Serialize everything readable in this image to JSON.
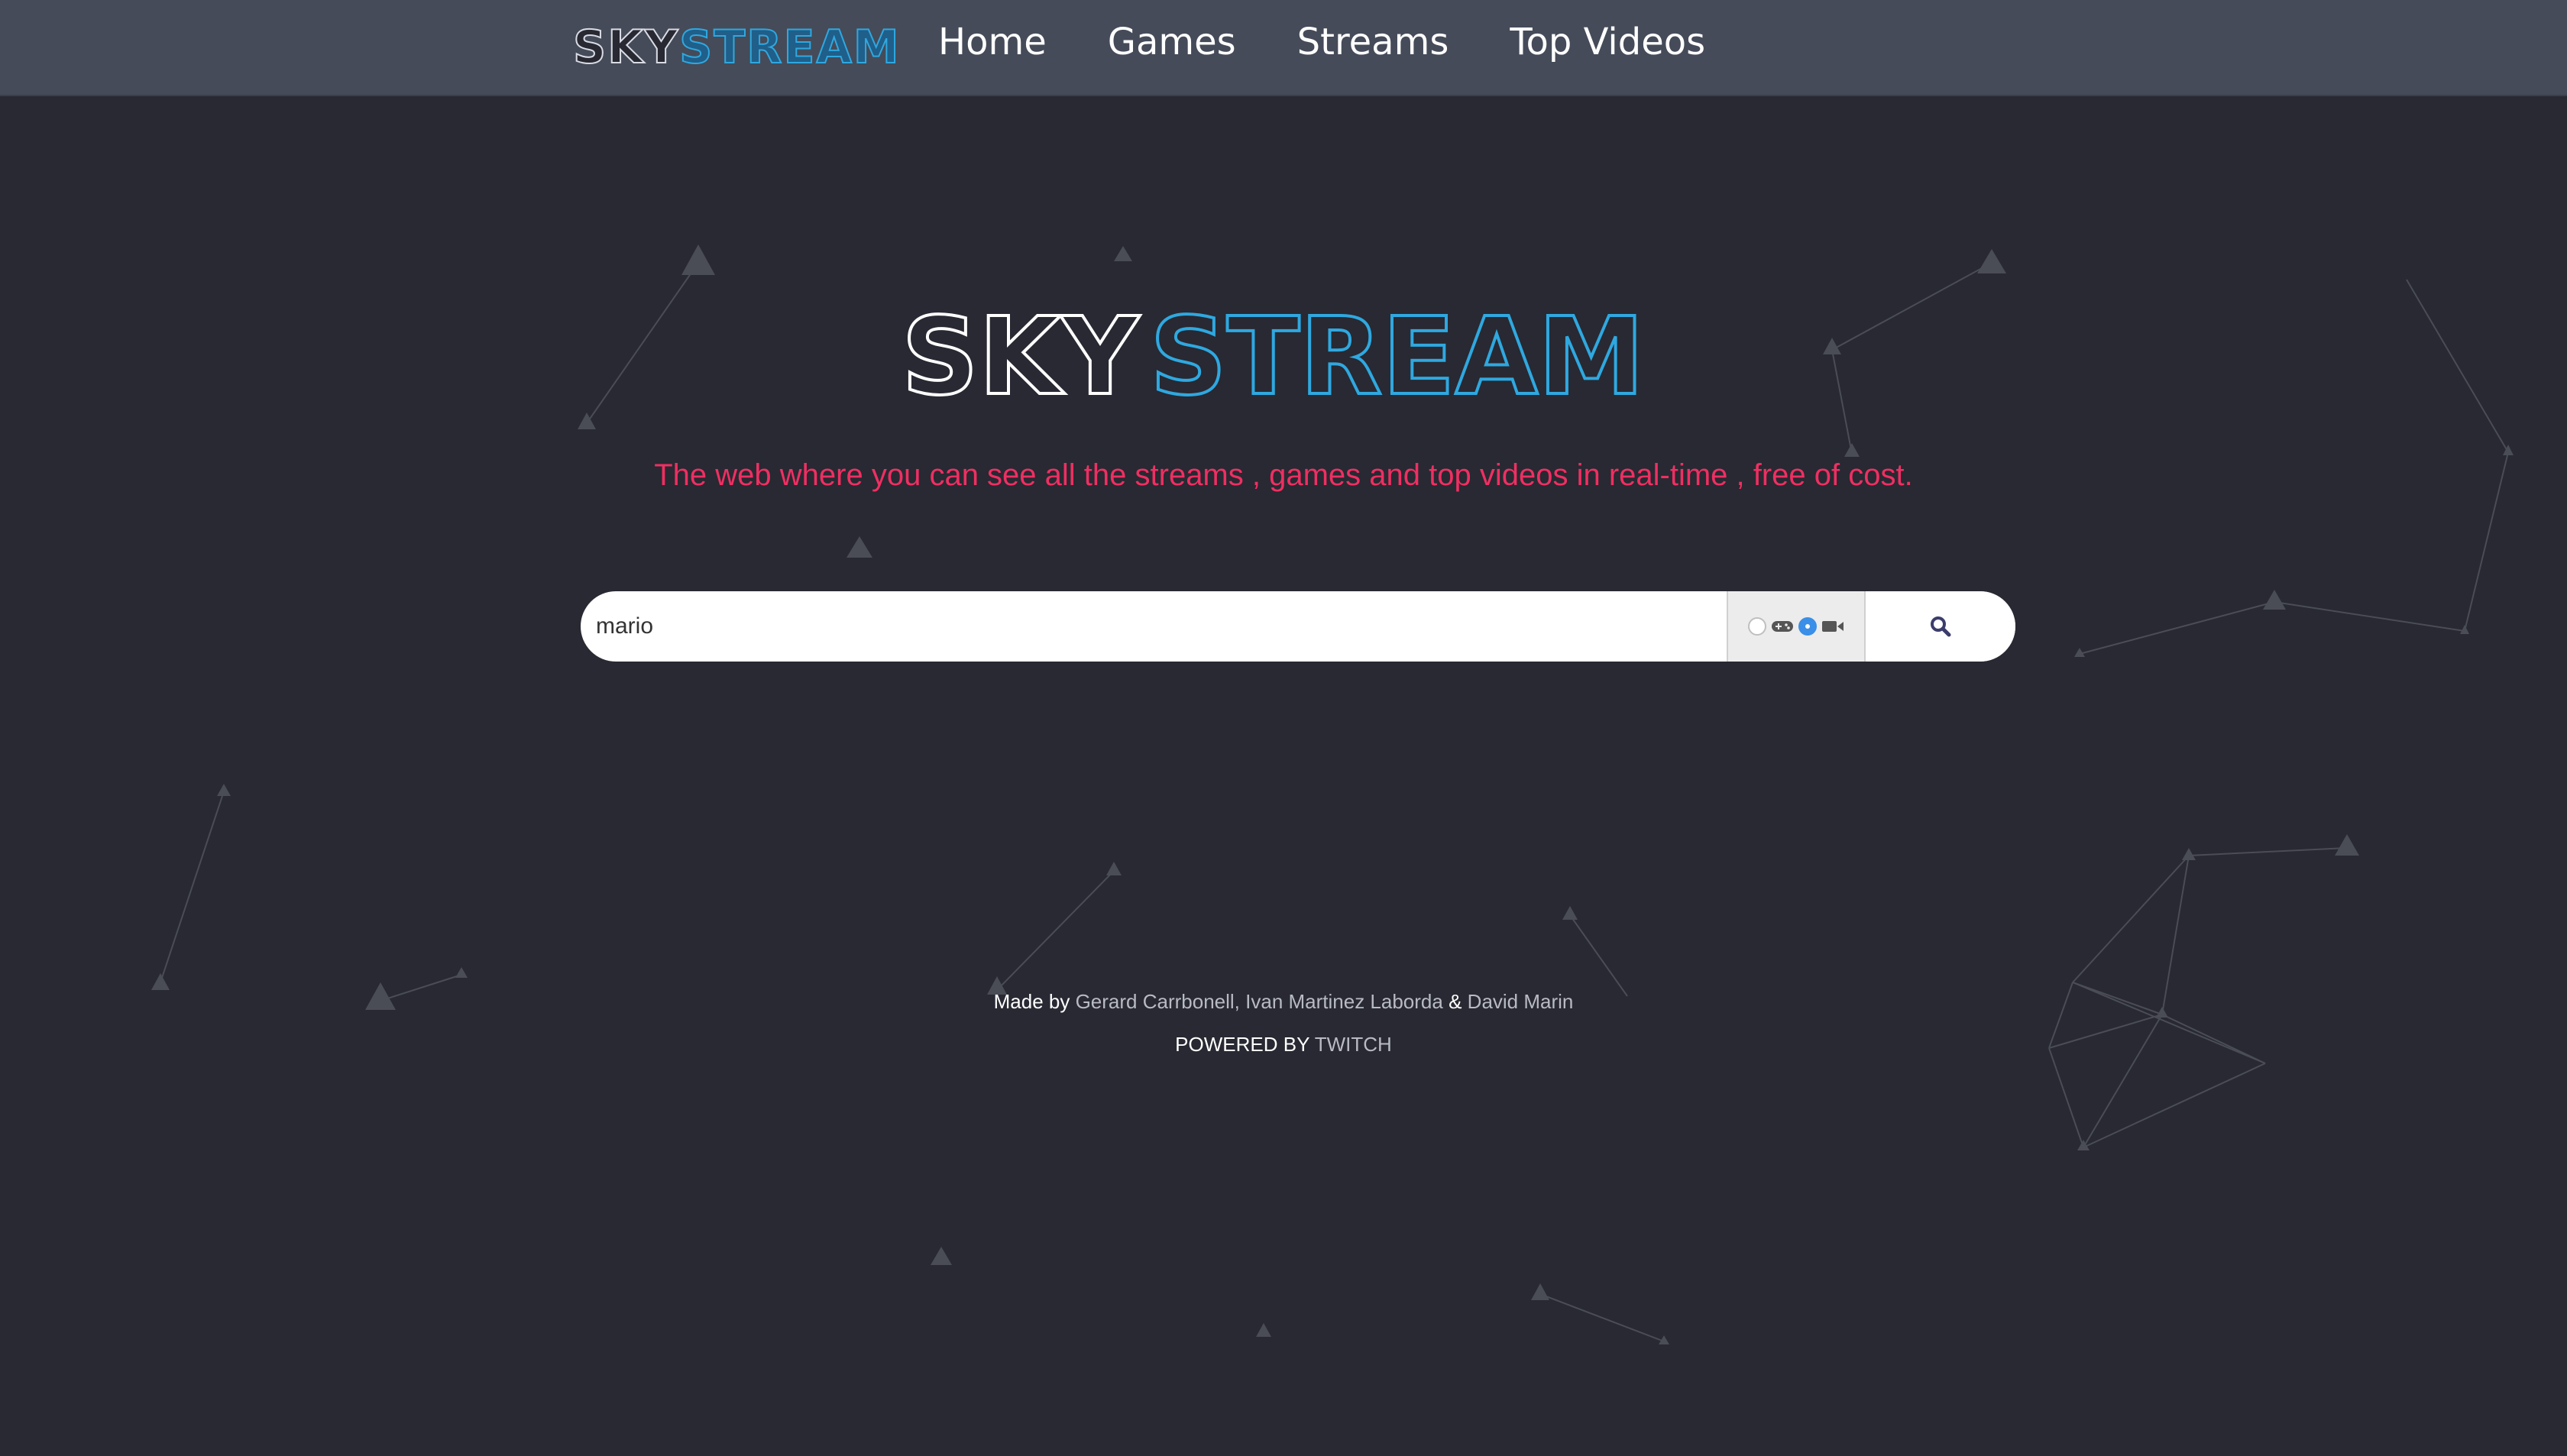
{
  "nav": {
    "logo_sky": "SKY",
    "logo_stream": "STREAM",
    "links": [
      {
        "label": "Home"
      },
      {
        "label": "Games"
      },
      {
        "label": "Streams"
      },
      {
        "label": "Top Videos"
      }
    ]
  },
  "hero": {
    "logo_sky": "SKY",
    "logo_stream": "STREAM",
    "tagline": "The web where you can see all the streams , games and top videos in real-time , free of cost."
  },
  "search": {
    "value": "mario",
    "mode_options": [
      {
        "icon": "gamepad-icon",
        "selected": false
      },
      {
        "icon": "video-camera-icon",
        "selected": true
      }
    ],
    "button_icon": "search-icon"
  },
  "footer": {
    "made_by_label": "Made by",
    "author_1": "Gerard Carrbonell",
    "sep_1": ",",
    "author_2": "Ivan Martinez Laborda",
    "amp": "&",
    "author_3": "David Marin",
    "powered_label": "POWERED BY",
    "powered_brand": "TWITCH"
  },
  "colors": {
    "background": "#282932",
    "navbar": "#454b59",
    "accent_blue": "#2fa8e0",
    "tagline_pink": "#ef2f62",
    "radio_selected": "#3a8fe8"
  }
}
